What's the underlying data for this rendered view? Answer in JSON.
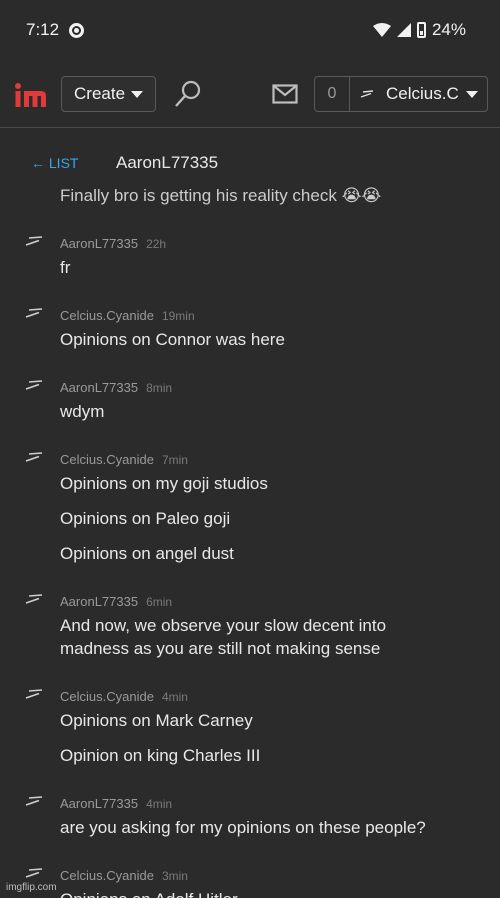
{
  "status_bar": {
    "time": "7:12",
    "battery": "24%"
  },
  "header": {
    "create_label": "Create",
    "notif_count": "0",
    "username": "Celcius.C"
  },
  "conversation": {
    "back_label": "← LIST",
    "title": "AaronL77335"
  },
  "messages": [
    {
      "partial_text": "Finally bro is getting his reality check 😭😭"
    },
    {
      "user": "AaronL77335",
      "time": "22h",
      "lines": [
        "fr"
      ]
    },
    {
      "user": "Celcius.Cyanide",
      "time": "19min",
      "lines": [
        "Opinions on Connor was here"
      ]
    },
    {
      "user": "AaronL77335",
      "time": "8min",
      "lines": [
        "wdym"
      ]
    },
    {
      "user": "Celcius.Cyanide",
      "time": "7min",
      "lines": [
        "Opinions on my goji studios",
        "Opinions on Paleo goji",
        "Opinions on angel dust"
      ]
    },
    {
      "user": "AaronL77335",
      "time": "6min",
      "lines": [
        "And now, we observe your slow decent into",
        "madness as you are still not making sense"
      ]
    },
    {
      "user": "Celcius.Cyanide",
      "time": "4min",
      "lines": [
        "Opinions on Mark Carney",
        "Opinion on king Charles III"
      ]
    },
    {
      "user": "AaronL77335",
      "time": "4min",
      "lines": [
        "are you asking for my opinions on these people?"
      ]
    },
    {
      "user": "Celcius.Cyanide",
      "time": "3min",
      "lines": [
        "Opinions on Adolf Hitler"
      ]
    }
  ],
  "watermark": "imgflip.com"
}
